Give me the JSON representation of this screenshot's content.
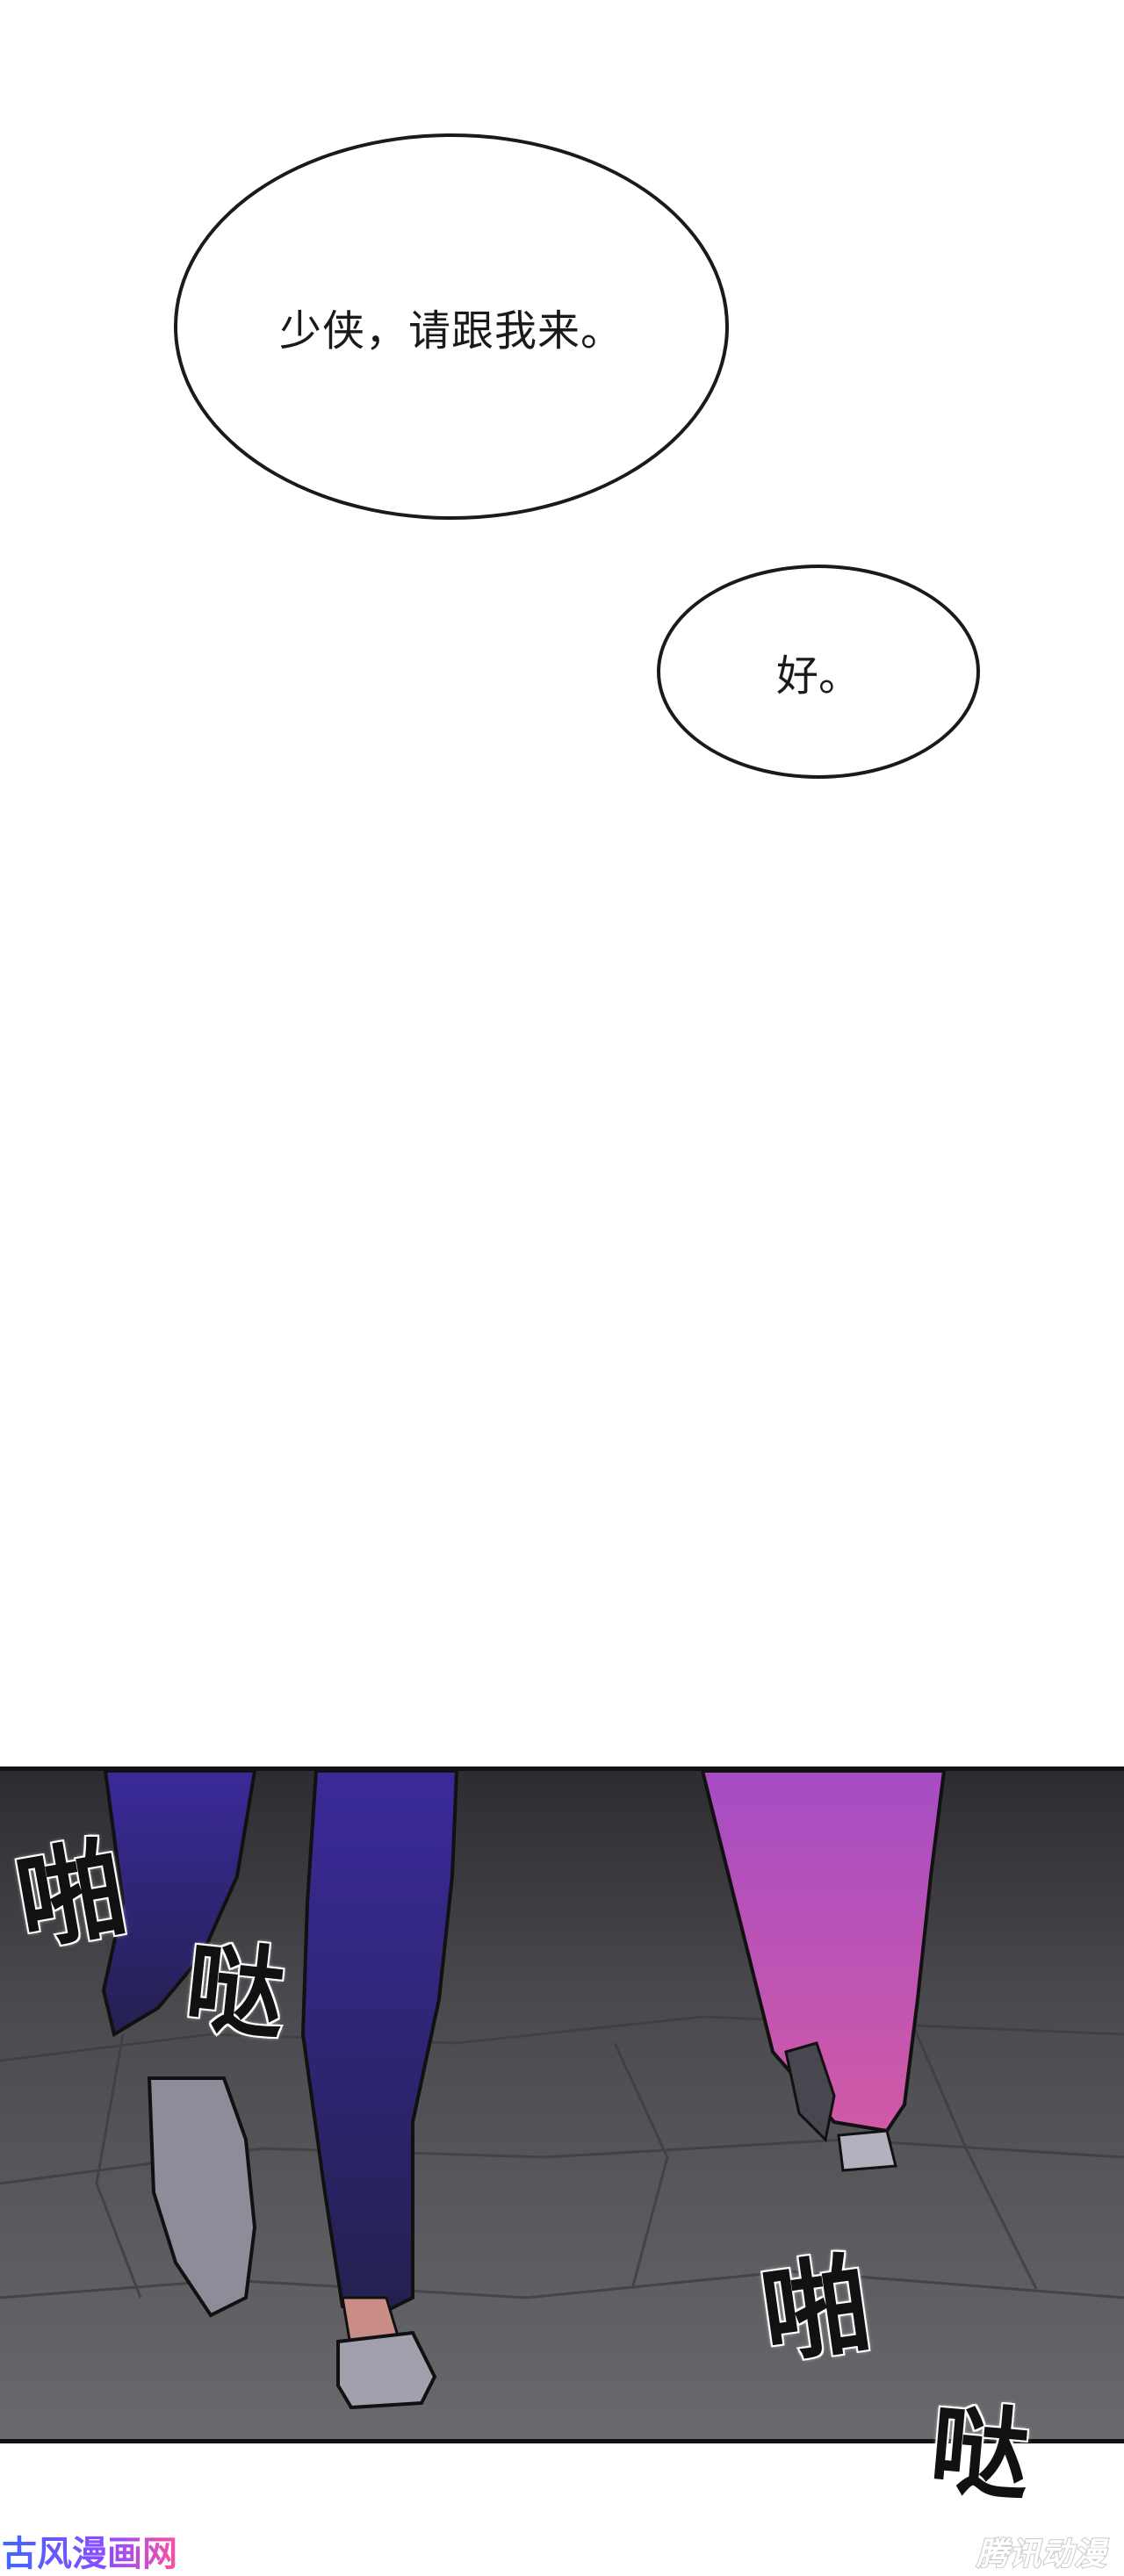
{
  "dialogue": {
    "bubble_1": "少侠，请跟我来。",
    "bubble_2": "好。"
  },
  "sfx": {
    "top_left": [
      "啪",
      "哒"
    ],
    "bottom_right": [
      "啪",
      "哒"
    ]
  },
  "watermarks": {
    "left": "古风漫画网",
    "right": "腾讯动漫"
  },
  "colors": {
    "floor": "#5a5a5e",
    "floor_dark": "#2c2c31",
    "left_trousers": "#2a1f6e",
    "right_robe": "#c155c8",
    "shoe": "#8f8c9a"
  }
}
